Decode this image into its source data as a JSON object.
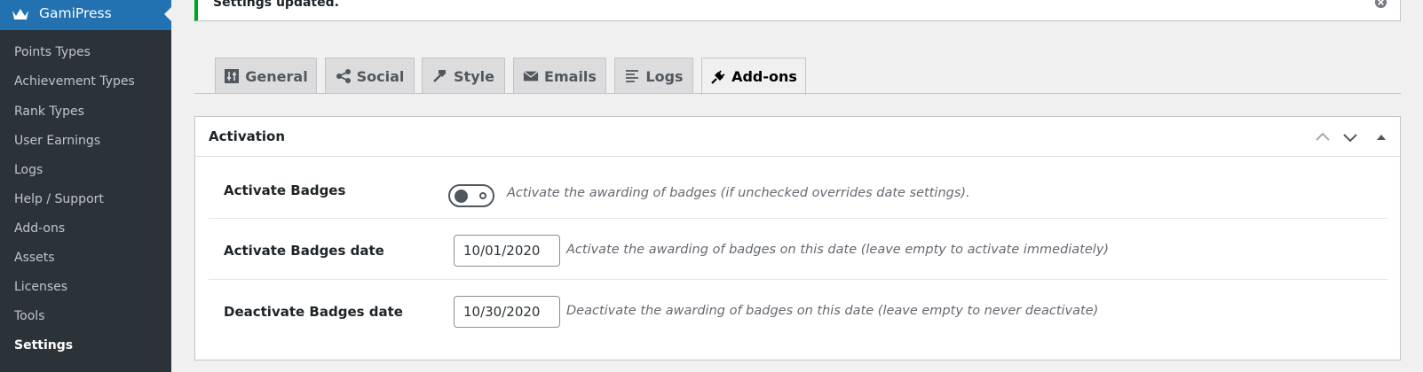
{
  "sidebar": {
    "brand": "GamiPress",
    "items": [
      {
        "label": "Points Types"
      },
      {
        "label": "Achievement Types"
      },
      {
        "label": "Rank Types"
      },
      {
        "label": "User Earnings"
      },
      {
        "label": "Logs"
      },
      {
        "label": "Help / Support"
      },
      {
        "label": "Add-ons"
      },
      {
        "label": "Assets"
      },
      {
        "label": "Licenses"
      },
      {
        "label": "Tools"
      },
      {
        "label": "Settings",
        "current": true
      }
    ]
  },
  "notice": {
    "text": "Settings updated.",
    "status_color": "#00a32a"
  },
  "tabs": [
    {
      "label": "General",
      "icon": "sliders-icon"
    },
    {
      "label": "Social",
      "icon": "share-icon"
    },
    {
      "label": "Style",
      "icon": "paint-brush-icon"
    },
    {
      "label": "Emails",
      "icon": "email-icon"
    },
    {
      "label": "Logs",
      "icon": "list-icon"
    },
    {
      "label": "Add-ons",
      "icon": "plugin-icon",
      "active": true
    }
  ],
  "panel": {
    "title": "Activation",
    "fields": [
      {
        "label": "Activate Badges",
        "type": "toggle",
        "checked": false,
        "description": "Activate the awarding of badges (if unchecked overrides date settings)."
      },
      {
        "label": "Activate Badges date",
        "type": "date",
        "value": "10/01/2020",
        "description": "Activate the awarding of badges on this date (leave empty to activate immediately)"
      },
      {
        "label": "Deactivate Badges date",
        "type": "date",
        "value": "10/30/2020",
        "description": "Deactivate the awarding of badges on this date (leave empty to never deactivate)"
      }
    ]
  },
  "colors": {
    "sidebar_bg": "#2c3338",
    "brand_bg": "#2271b1",
    "page_bg": "#f0f0f1"
  }
}
